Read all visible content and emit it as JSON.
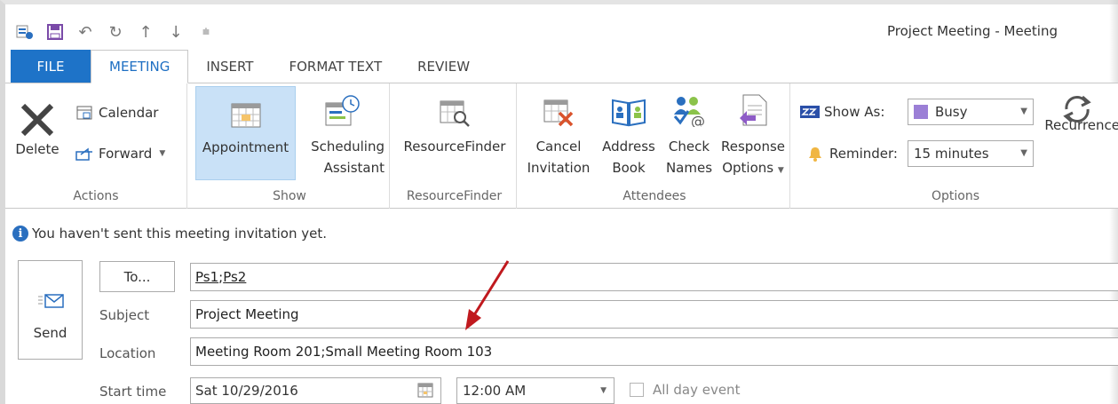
{
  "window": {
    "title": "Project Meeting - Meeting"
  },
  "tabs": [
    "FILE",
    "MEETING",
    "INSERT",
    "FORMAT TEXT",
    "REVIEW"
  ],
  "ribbon": {
    "actions": {
      "delete": "Delete",
      "calendar": "Calendar",
      "forward": "Forward",
      "label": "Actions"
    },
    "show": {
      "appointment": "Appointment",
      "scheduling1": "Scheduling",
      "scheduling2": "Assistant",
      "label": "Show"
    },
    "resource": {
      "finder": "ResourceFinder",
      "label": "ResourceFinder"
    },
    "attendees": {
      "cancel1": "Cancel",
      "cancel2": "Invitation",
      "address1": "Address",
      "address2": "Book",
      "check1": "Check",
      "check2": "Names",
      "response1": "Response",
      "response2": "Options",
      "label": "Attendees"
    },
    "options": {
      "show_as_label": "Show As:",
      "show_as_value": "Busy",
      "reminder_label": "Reminder:",
      "reminder_value": "15 minutes",
      "recurrence": "Recurrence",
      "label": "Options"
    }
  },
  "info_bar": "You haven't sent this meeting invitation yet.",
  "form": {
    "send": "Send",
    "to_button": "To...",
    "to_1": "Ps1",
    "to_sep": "; ",
    "to_2": "Ps2",
    "subject_label": "Subject",
    "subject": "Project Meeting",
    "location_label": "Location",
    "location": "Meeting Room 201;Small Meeting Room 103",
    "start_label": "Start time",
    "start_date": "Sat 10/29/2016",
    "start_time": "12:00 AM",
    "all_day": "All day event"
  },
  "colors": {
    "file_tab": "#1e73c8",
    "busy": "#9b7fd6",
    "annotation_arrow": "#c0191e",
    "selected": "#c9e1f7"
  }
}
